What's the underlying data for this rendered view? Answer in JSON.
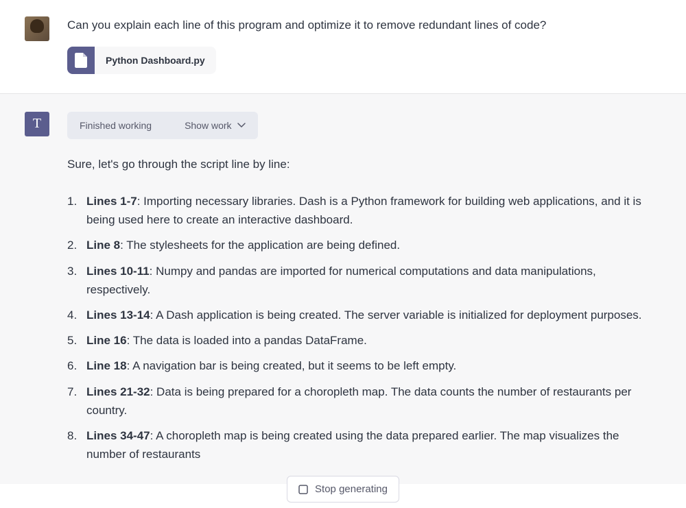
{
  "user": {
    "question": "Can you explain each line of this program and optimize it to remove redundant lines of code?",
    "attachment": {
      "filename": "Python Dashboard.py"
    }
  },
  "assistant": {
    "avatar_letter": "T",
    "status": {
      "label": "Finished working",
      "toggle": "Show work"
    },
    "intro": "Sure, let's go through the script line by line:",
    "items": [
      {
        "prefix": "Lines 1-7",
        "text": ": Importing necessary libraries. Dash is a Python framework for building web applications, and it is being used here to create an interactive dashboard."
      },
      {
        "prefix": "Line 8",
        "text": ": The stylesheets for the application are being defined."
      },
      {
        "prefix": "Lines 10-11",
        "text": ": Numpy and pandas are imported for numerical computations and data manipulations, respectively."
      },
      {
        "prefix": "Lines 13-14",
        "text": ": A Dash application is being created. The server variable is initialized for deployment purposes."
      },
      {
        "prefix": "Line 16",
        "text": ": The data is loaded into a pandas DataFrame."
      },
      {
        "prefix": "Line 18",
        "text": ": A navigation bar is being created, but it seems to be left empty."
      },
      {
        "prefix": "Lines 21-32",
        "text": ": Data is being prepared for a choropleth map. The data counts the number of restaurants per country."
      },
      {
        "prefix": "Lines 34-47",
        "text": ": A choropleth map is being created using the data prepared earlier. The map visualizes the number of restaurants"
      }
    ]
  },
  "controls": {
    "stop": "Stop generating"
  }
}
